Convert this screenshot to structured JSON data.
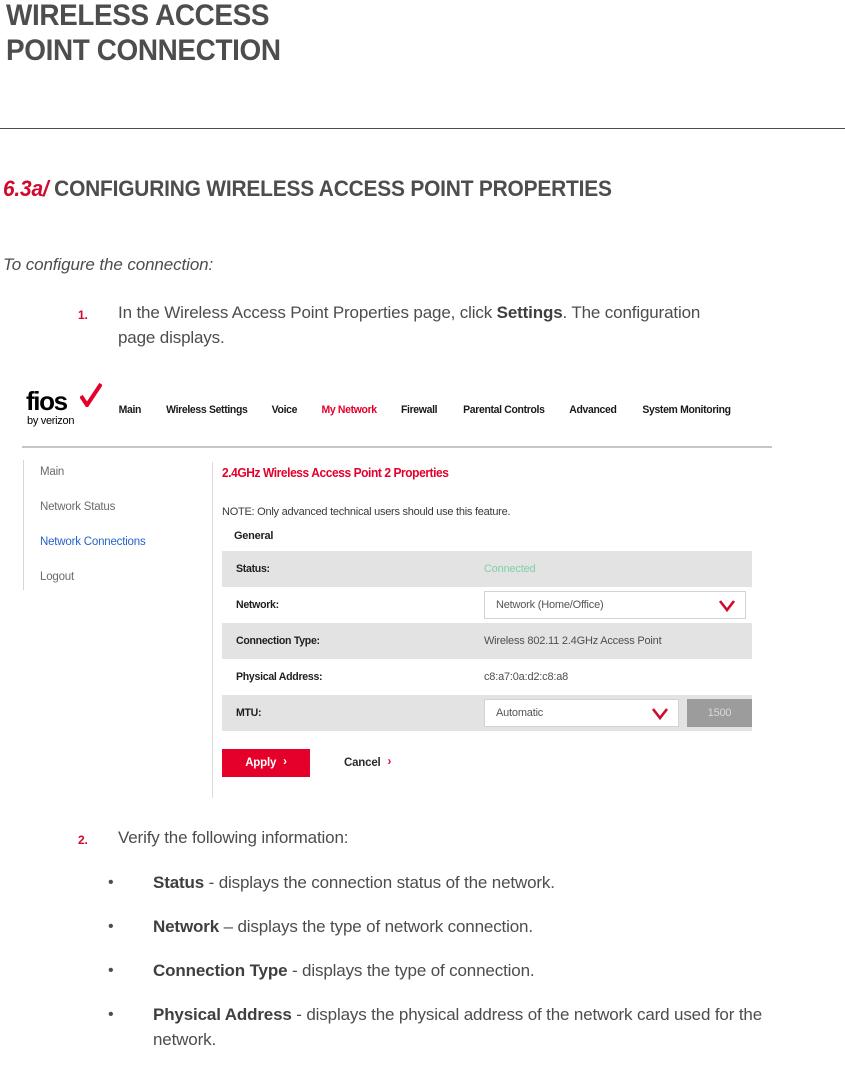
{
  "document": {
    "title_line1": "WIRELESS ACCESS",
    "title_line2": "POINT CONNECTION",
    "section_number": "6.3a/",
    "section_title": "CONFIGURING WIRELESS ACCESS POINT PROPERTIES",
    "intro_italic": "To configure the connection:"
  },
  "steps": [
    {
      "marker": "1.",
      "text_before": "In the Wireless Access Point Properties page, click ",
      "bold": "Settings",
      "text_after": ". The configuration page displays."
    },
    {
      "marker": "2.",
      "text": "Verify the following information:"
    }
  ],
  "bullets": [
    {
      "dot": "•",
      "term": "Status",
      "desc": " - displays the connection status of the network."
    },
    {
      "dot": "•",
      "term": "Network",
      "desc": " – displays the type of network connection."
    },
    {
      "dot": "•",
      "term": "Connection Type",
      "desc": " - displays the type of connection."
    },
    {
      "dot": "•",
      "term": "Physical Address",
      "desc": " - displays the physical address of the network card used for the network."
    }
  ],
  "screenshot": {
    "brand": {
      "wordmark": "fios",
      "tagline": "by verizon",
      "check_color": "#e4002b"
    },
    "nav": [
      {
        "label": "Main",
        "active": false
      },
      {
        "label": "Wireless Settings",
        "active": false
      },
      {
        "label": "Voice",
        "active": false
      },
      {
        "label": "My Network",
        "active": true
      },
      {
        "label": "Firewall",
        "active": false
      },
      {
        "label": "Parental Controls",
        "active": false
      },
      {
        "label": "Advanced",
        "active": false
      },
      {
        "label": "System Monitoring",
        "active": false
      }
    ],
    "sidebar": [
      {
        "label": "Main",
        "active": false
      },
      {
        "label": "Network Status",
        "active": false
      },
      {
        "label": "Network Connections",
        "active": true
      },
      {
        "label": "Logout",
        "active": false
      }
    ],
    "panel": {
      "title": "2.4GHz Wireless Access Point 2 Properties",
      "note": "NOTE: Only advanced technical users should use this feature.",
      "group_label": "General",
      "rows": [
        {
          "label": "Status:",
          "value": "Connected",
          "kind": "status"
        },
        {
          "label": "Network:",
          "value": "Network (Home/Office)",
          "kind": "select"
        },
        {
          "label": "Connection Type:",
          "value": "Wireless 802.11 2.4GHz Access Point",
          "kind": "text"
        },
        {
          "label": "Physical Address:",
          "value": "c8:a7:0a:d2:c8:a8",
          "kind": "text"
        },
        {
          "label": "MTU:",
          "value": "Automatic",
          "extra_value": "1500",
          "kind": "select-mtu"
        }
      ]
    },
    "actions": {
      "apply_label": "Apply",
      "cancel_label": "Cancel",
      "chevron": "›"
    },
    "colors": {
      "brand_red": "#e4002b",
      "accent_red": "#cf0a2c",
      "link_blue": "#2563c9",
      "status_green": "#7fd0a8",
      "row_shade": "#e3e3e3"
    }
  }
}
